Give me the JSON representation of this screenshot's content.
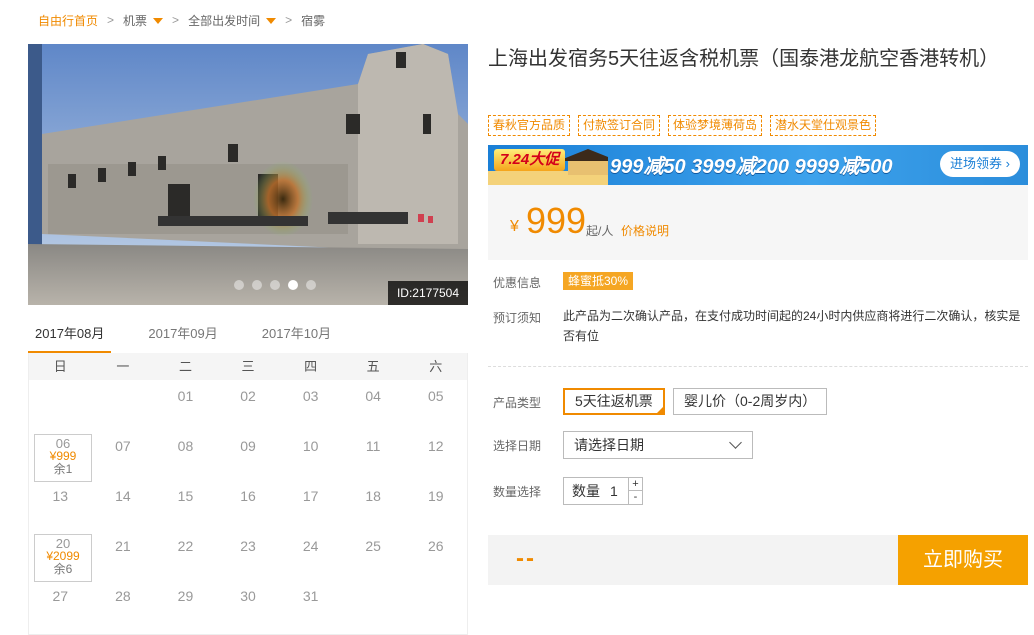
{
  "breadcrumb": {
    "home": "自由行首页",
    "category": "机票",
    "departure": "全部出发时间",
    "destination": "宿雾"
  },
  "gallery": {
    "id_label": "ID:2177504",
    "dots": 5,
    "active_dot": 4
  },
  "calendar": {
    "months": [
      "2017年08月",
      "2017年09月",
      "2017年10月"
    ],
    "active_month": 0,
    "weekdays": [
      "日",
      "一",
      "二",
      "三",
      "四",
      "五",
      "六"
    ],
    "weeks": [
      [
        {
          "day": ""
        },
        {
          "day": ""
        },
        {
          "day": "01"
        },
        {
          "day": "02"
        },
        {
          "day": "03"
        },
        {
          "day": "04"
        },
        {
          "day": "05"
        }
      ],
      [
        {
          "day": "06",
          "price": "¥999",
          "remain": "余1"
        },
        {
          "day": "07"
        },
        {
          "day": "08"
        },
        {
          "day": "09"
        },
        {
          "day": "10"
        },
        {
          "day": "11"
        },
        {
          "day": "12"
        }
      ],
      [
        {
          "day": "13"
        },
        {
          "day": "14"
        },
        {
          "day": "15"
        },
        {
          "day": "16"
        },
        {
          "day": "17"
        },
        {
          "day": "18"
        },
        {
          "day": "19"
        }
      ],
      [
        {
          "day": "20",
          "price": "¥2099",
          "remain": "余6"
        },
        {
          "day": "21"
        },
        {
          "day": "22"
        },
        {
          "day": "23"
        },
        {
          "day": "24"
        },
        {
          "day": "25"
        },
        {
          "day": "26"
        }
      ],
      [
        {
          "day": "27"
        },
        {
          "day": "28"
        },
        {
          "day": "29"
        },
        {
          "day": "30"
        },
        {
          "day": "31"
        },
        {
          "day": ""
        },
        {
          "day": ""
        }
      ]
    ]
  },
  "product": {
    "title": "上海出发宿务5天往返含税机票（国泰港龙航空香港转机）",
    "tags": [
      "春秋官方品质",
      "付款签订合同",
      "体验梦境薄荷岛",
      "潜水天堂仕观景色"
    ]
  },
  "promo": {
    "badge": "7.24大促",
    "deals": "999减50  3999减200  9999减500",
    "coupon": "进场领券 ›"
  },
  "price": {
    "currency": "¥",
    "amount": "999",
    "unit": "起/人",
    "explain": "价格说明"
  },
  "info": {
    "discount_label": "优惠信息",
    "discount_value": "蜂蜜抵30%",
    "notice_label": "预订须知",
    "notice_value": "此产品为二次确认产品，在支付成功时间起的24小时内供应商将进行二次确认，核实是否有位"
  },
  "options": {
    "type_label": "产品类型",
    "type_selected": "5天往返机票",
    "type_other": "婴儿价（0-2周岁内）",
    "date_label": "选择日期",
    "date_placeholder": "请选择日期",
    "qty_label": "数量选择",
    "qty_prefix": "数量",
    "qty_value": "1",
    "plus": "+",
    "minus": "-"
  },
  "buy": {
    "total": "--",
    "button": "立即购买"
  },
  "colors": {
    "accent": "#f08a00",
    "buy_button": "#f5a100",
    "promo_blue": "#1a7fd6"
  }
}
